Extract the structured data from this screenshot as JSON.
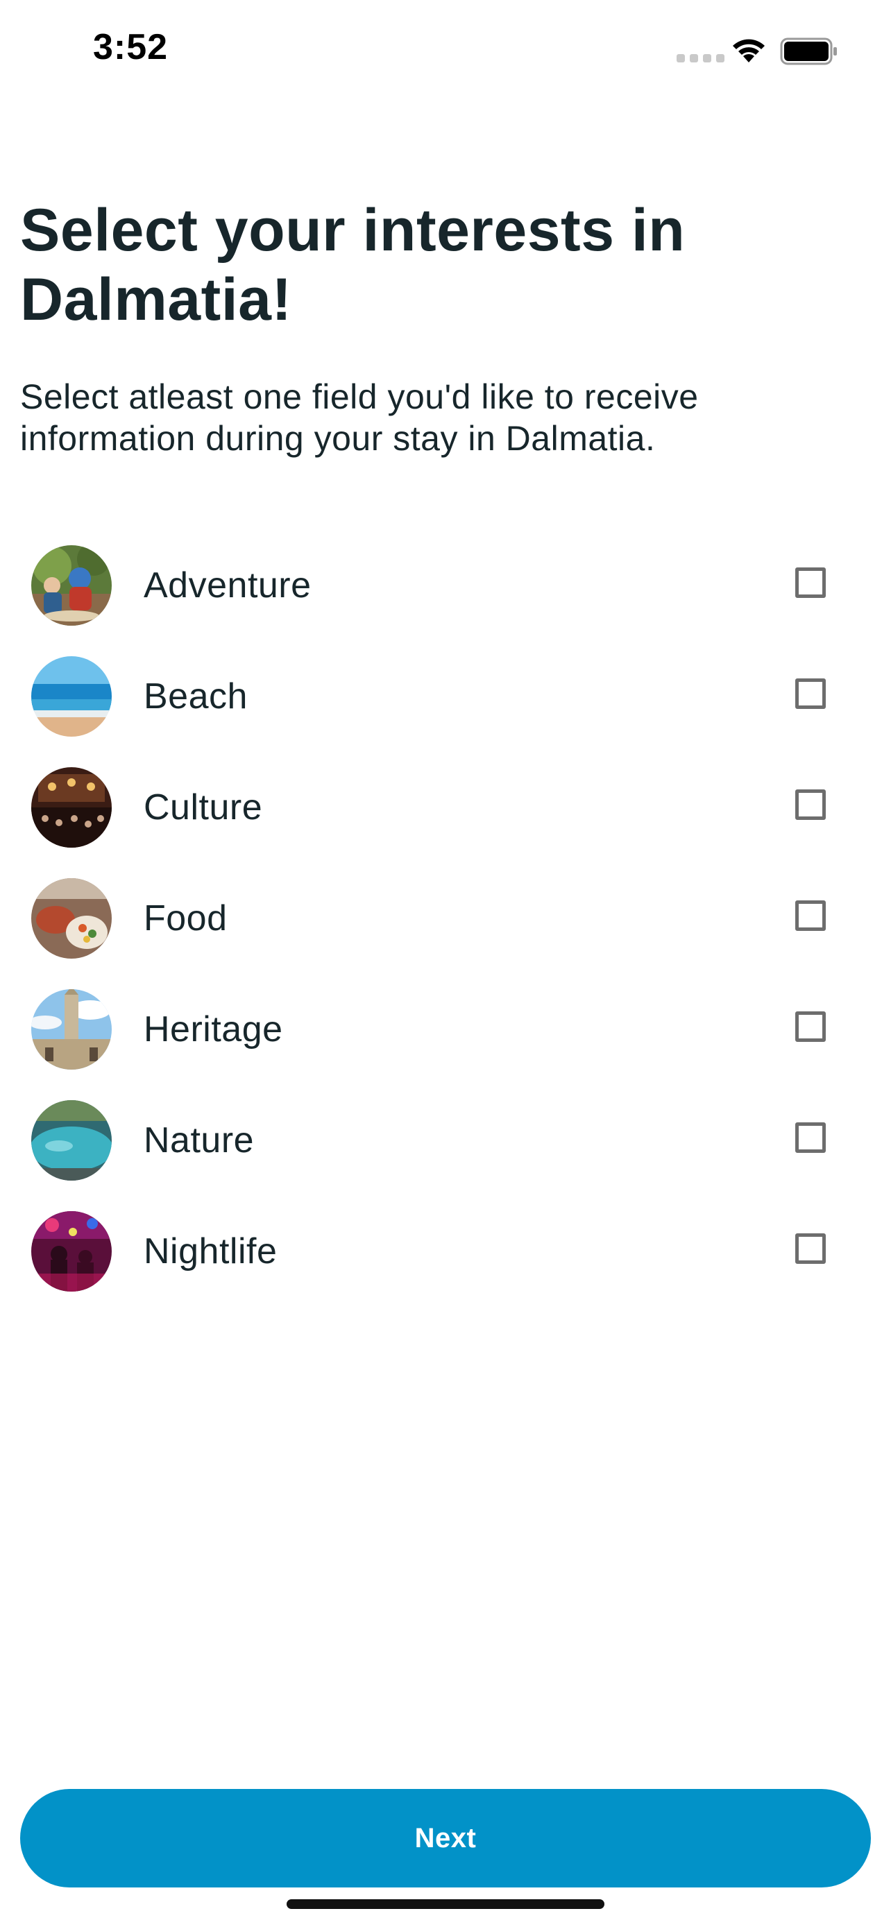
{
  "status_bar": {
    "time": "3:52"
  },
  "header": {
    "title": "Select your interests in Dalmatia!",
    "subtitle": "Select atleast one field you'd like to receive information during your stay in Dalmatia."
  },
  "interests": [
    {
      "label": "Adventure",
      "checked": false,
      "icon": "adventure-photo"
    },
    {
      "label": "Beach",
      "checked": false,
      "icon": "beach-photo"
    },
    {
      "label": "Culture",
      "checked": false,
      "icon": "culture-photo"
    },
    {
      "label": "Food",
      "checked": false,
      "icon": "food-photo"
    },
    {
      "label": "Heritage",
      "checked": false,
      "icon": "heritage-photo"
    },
    {
      "label": "Nature",
      "checked": false,
      "icon": "nature-photo"
    },
    {
      "label": "Nightlife",
      "checked": false,
      "icon": "nightlife-photo"
    }
  ],
  "footer": {
    "next_label": "Next"
  },
  "colors": {
    "accent": "#0292c8",
    "text": "#17262b",
    "checkbox_border": "#6d6d6d"
  }
}
